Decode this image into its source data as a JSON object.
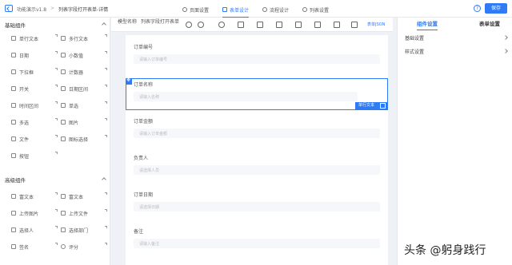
{
  "header": {
    "app_name": "功能演示v1.8",
    "separator": ">",
    "form_name": "列表字段打开表单-详情",
    "tabs": [
      {
        "label": "页面设置"
      },
      {
        "label": "表单设计"
      },
      {
        "label": "流程设计"
      },
      {
        "label": "列表设置"
      }
    ],
    "help": "?",
    "save_label": "保存"
  },
  "left_panel": {
    "basic_group": "基础组件",
    "basic_items": [
      "单行文本",
      "多行文本",
      "日期",
      "小数值",
      "下拉框",
      "计数器",
      "开关",
      "日期区间",
      "时间区间",
      "单选",
      "多选",
      "图片",
      "文件",
      "图标选择",
      "按钮"
    ],
    "advanced_group": "高级组件",
    "advanced_items": [
      "富文本",
      "富文本",
      "上传图片",
      "上传文件",
      "选择人",
      "选择部门",
      "签名",
      "评分"
    ]
  },
  "toolbar": {
    "model_label": "模型名称",
    "list_label": "列表字段打开表单",
    "json_text": "表单JSON"
  },
  "canvas": {
    "fields": [
      {
        "label": "订单编号",
        "placeholder": "请输入订单编号"
      },
      {
        "label": "订单名称",
        "placeholder": "请输入名称"
      },
      {
        "label": "订单金额",
        "placeholder": "请输入订单金额"
      },
      {
        "label": "负责人",
        "placeholder": "请选择人员"
      },
      {
        "label": "订单日期",
        "placeholder": "请选择日期"
      },
      {
        "label": "备注",
        "placeholder": "请输入备注"
      }
    ],
    "selected_tag": "单行文本"
  },
  "right_panel": {
    "tabs": [
      {
        "label": "组件设置"
      },
      {
        "label": "表单设置"
      }
    ],
    "rows": [
      "基础设置",
      "样式设置"
    ]
  },
  "watermark": "头条 @躬身践行",
  "colors": {
    "accent": "#2f7bf5",
    "background": "#eef1f6"
  }
}
